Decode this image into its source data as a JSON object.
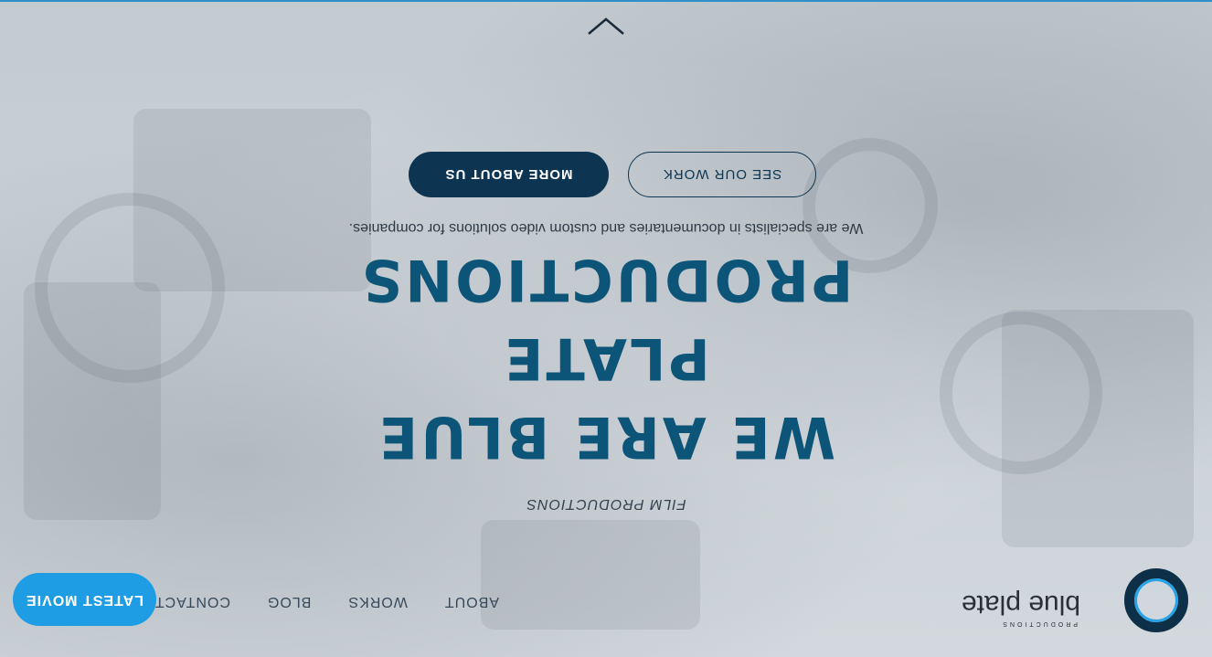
{
  "brand": {
    "name": "blue plate",
    "tagline": "PRODUCTIONS"
  },
  "nav": {
    "items": [
      {
        "label": "ABOUT"
      },
      {
        "label": "WORKS"
      },
      {
        "label": "BLOG"
      },
      {
        "label": "CONTACT"
      }
    ],
    "cta_label": "LATEST MOVIE"
  },
  "hero": {
    "kicker": "FILM PRODUCTIONS",
    "title_lines": [
      "WE ARE BLUE",
      "PLATE",
      "PRODUCTIONS"
    ],
    "subtitle": "We are specialists in documentaries and custom video solutions for companies.",
    "primary_button": "SEE OUR WORK",
    "secondary_button": "MORE ABOUT US"
  },
  "icons": {
    "scroll": "chevron-up-icon"
  },
  "colors": {
    "accent": "#1e9de4",
    "brand_dark": "#0d3450",
    "title": "#0d5578"
  }
}
